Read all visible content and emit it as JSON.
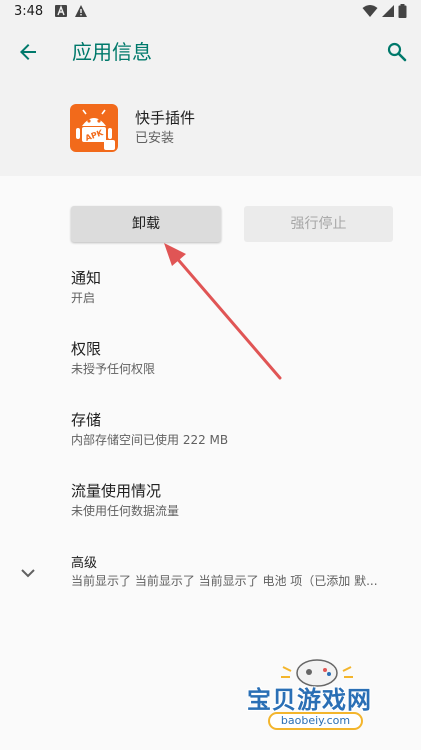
{
  "status_bar": {
    "time": "3:48",
    "icons": [
      "notification-a-icon",
      "warning-icon",
      "wifi-icon",
      "signal-icon",
      "battery-icon"
    ]
  },
  "toolbar": {
    "title": "应用信息",
    "back_icon": "back-arrow-icon",
    "search_icon": "search-icon"
  },
  "app": {
    "name": "快手插件",
    "status": "已安装",
    "icon": "apk-android-icon",
    "icon_text": "APK"
  },
  "buttons": {
    "uninstall": "卸载",
    "force_stop": "强行停止"
  },
  "settings": [
    {
      "title": "通知",
      "subtitle": "开启"
    },
    {
      "title": "权限",
      "subtitle": "未授予任何权限"
    },
    {
      "title": "存储",
      "subtitle": "内部存储空间已使用 222 MB"
    },
    {
      "title": "流量使用情况",
      "subtitle": "未使用任何数据流量"
    }
  ],
  "advanced": {
    "title": "高级",
    "subtitle": "当前显示了 当前显示了 当前显示了 电池 项（已添加 默..."
  },
  "watermark": {
    "text": "宝贝游戏网",
    "url": "baobeiy.com"
  },
  "colors": {
    "accent": "#00796b",
    "arrow": "#e05555",
    "app_icon_bg": "#f26a1b"
  }
}
